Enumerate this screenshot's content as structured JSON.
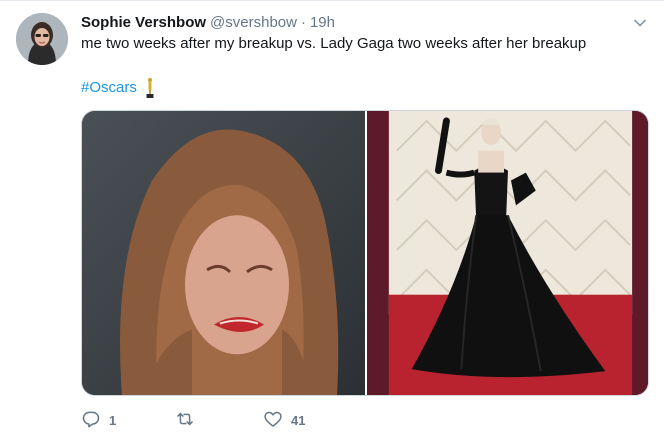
{
  "tweet": {
    "display_name": "Sophie Vershbow",
    "handle": "@svershbow",
    "separator": "·",
    "time": "19h",
    "text": "me two weeks after my breakup vs. Lady Gaga two weeks after her breakup",
    "hashtag": "#Oscars",
    "emoji": "oscar-trophy-emoji"
  },
  "actions": {
    "replies": "1",
    "retweets": "",
    "likes": "41"
  },
  "colors": {
    "link": "#1b95e0",
    "muted": "#657786",
    "text": "#14171a",
    "border": "#ccd6dd"
  },
  "icons": {
    "menu": "chevron-down-icon",
    "reply": "reply-icon",
    "retweet": "retweet-icon",
    "like": "heart-icon"
  }
}
